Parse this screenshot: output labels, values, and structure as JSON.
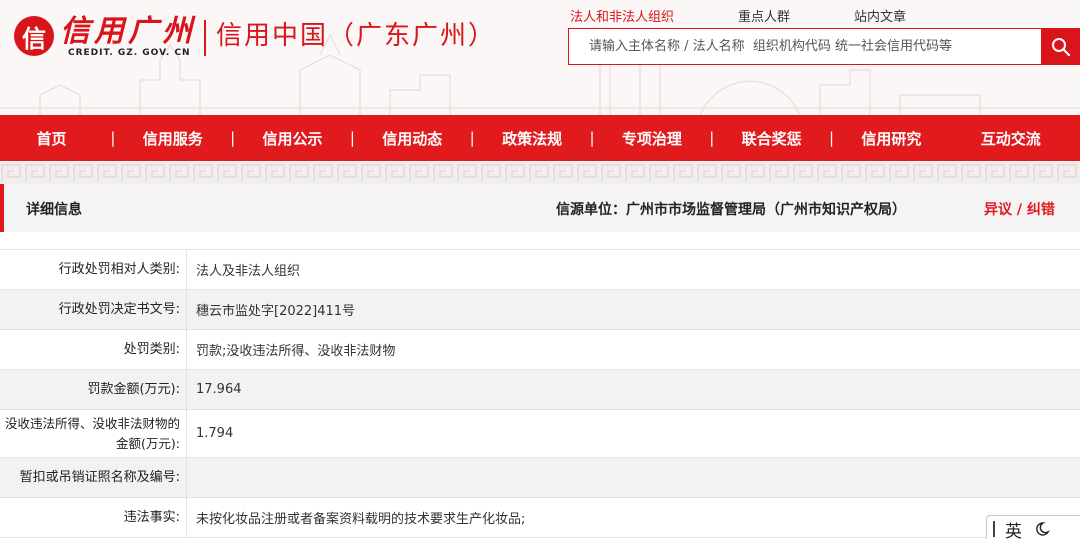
{
  "header": {
    "logo_mark": "信",
    "logo_title": "信用广州",
    "logo_subtitle": "CREDIT. GZ. GOV. CN",
    "site_name": "信用中国（广东广州）"
  },
  "search": {
    "tabs": [
      {
        "label": "法人和非法人组织",
        "active": true
      },
      {
        "label": "重点人群",
        "active": false
      },
      {
        "label": "站内文章",
        "active": false
      }
    ],
    "placeholder": "请输入主体名称 / 法人名称  组织机构代码 统一社会信用代码等",
    "button_icon": "search-icon"
  },
  "nav": {
    "items": [
      "首页",
      "信用服务",
      "信用公示",
      "信用动态",
      "政策法规",
      "专项治理",
      "联合奖惩",
      "信用研究",
      "互动交流"
    ],
    "separator": "|"
  },
  "detail": {
    "title": "详细信息",
    "source": "信源单位：广州市市场监督管理局（广州市知识产权局）",
    "dispute_link": "异议 / 纠错"
  },
  "info_rows": [
    {
      "label": "行政处罚相对人类别:",
      "value": "法人及非法人组织"
    },
    {
      "label": "行政处罚决定书文号:",
      "value": "穗云市监处字[2022]411号"
    },
    {
      "label": "处罚类别:",
      "value": "罚款;没收违法所得、没收非法财物"
    },
    {
      "label": "罚款金额(万元):",
      "value": "17.964"
    },
    {
      "label": "没收违法所得、没收非法财物的金额(万元):",
      "value": "1.794"
    },
    {
      "label": "暂扣或吊销证照名称及编号:",
      "value": ""
    },
    {
      "label": "违法事实:",
      "value": "未按化妆品注册或者备案资料载明的技术要求生产化妆品;"
    }
  ],
  "ime": {
    "mode": "英",
    "moon_icon": "moon-icon"
  },
  "colors": {
    "brand_red": "#e01a1d",
    "row_alt": "#f2f2f2"
  }
}
